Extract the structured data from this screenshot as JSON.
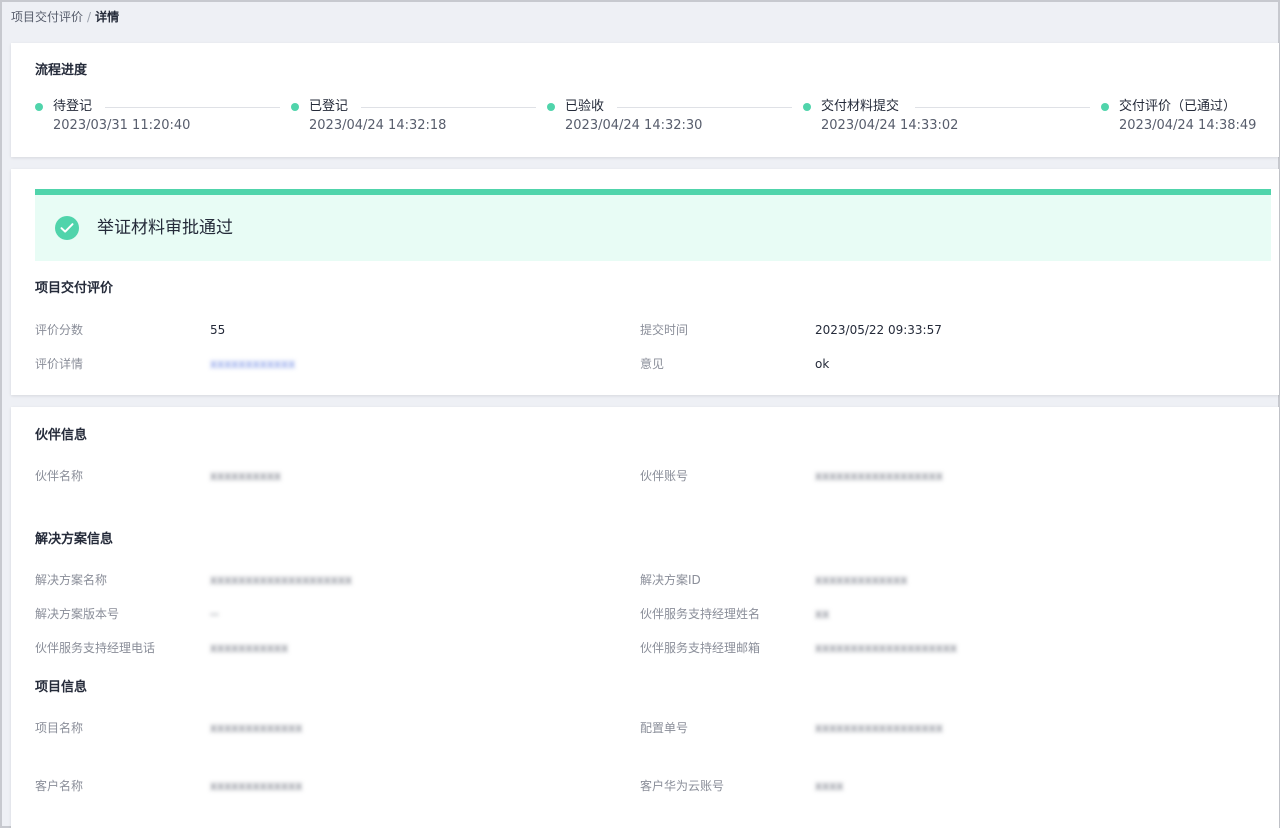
{
  "breadcrumb": {
    "parent": "项目交付评价",
    "separator": "/",
    "current": "详情"
  },
  "progress": {
    "title": "流程进度",
    "steps": [
      {
        "name": "待登记",
        "time": "2023/03/31 11:20:40"
      },
      {
        "name": "已登记",
        "time": "2023/04/24 14:32:18"
      },
      {
        "name": "已验收",
        "time": "2023/04/24 14:32:30"
      },
      {
        "name": "交付材料提交",
        "time": "2023/04/24 14:33:02"
      },
      {
        "name": "交付评价（已通过）",
        "time": "2023/04/24 14:38:49"
      }
    ]
  },
  "approval": {
    "message": "举证材料审批通过"
  },
  "evaluation": {
    "title": "项目交付评价",
    "score_label": "评价分数",
    "score_value": "55",
    "submit_time_label": "提交时间",
    "submit_time_value": "2023/05/22 09:33:57",
    "detail_label": "评价详情",
    "detail_value": "xxxxxxxxxxxx",
    "opinion_label": "意见",
    "opinion_value": "ok"
  },
  "partner": {
    "title": "伙伴信息",
    "name_label": "伙伴名称",
    "name_value": "xxxxxxxxxx",
    "account_label": "伙伴账号",
    "account_value": "xxxxxxxxxxxxxxxxxx"
  },
  "solution": {
    "title": "解决方案信息",
    "name_label": "解决方案名称",
    "name_value": "xxxxxxxxxxxxxxxxxxxx",
    "id_label": "解决方案ID",
    "id_value": "xxxxxxxxxxxxx",
    "version_label": "解决方案版本号",
    "version_value": "--",
    "manager_name_label": "伙伴服务支持经理姓名",
    "manager_name_value": "xx",
    "manager_phone_label": "伙伴服务支持经理电话",
    "manager_phone_value": "xxxxxxxxxxx",
    "manager_email_label": "伙伴服务支持经理邮箱",
    "manager_email_value": "xxxxxxxxxxxxxxxxxxxx"
  },
  "project": {
    "title": "项目信息",
    "name_label": "项目名称",
    "name_value": "xxxxxxxxxxxxx",
    "config_label": "配置单号",
    "config_value": "xxxxxxxxxxxxxxxxxx",
    "customer_label": "客户名称",
    "customer_value": "xxxxxxxxxxxxx",
    "cloud_account_label": "客户华为云账号",
    "cloud_account_value": "xxxx"
  },
  "colors": {
    "accent": "#50d4ab",
    "banner_bg": "#e8fcf5",
    "link": "#526ecc"
  }
}
